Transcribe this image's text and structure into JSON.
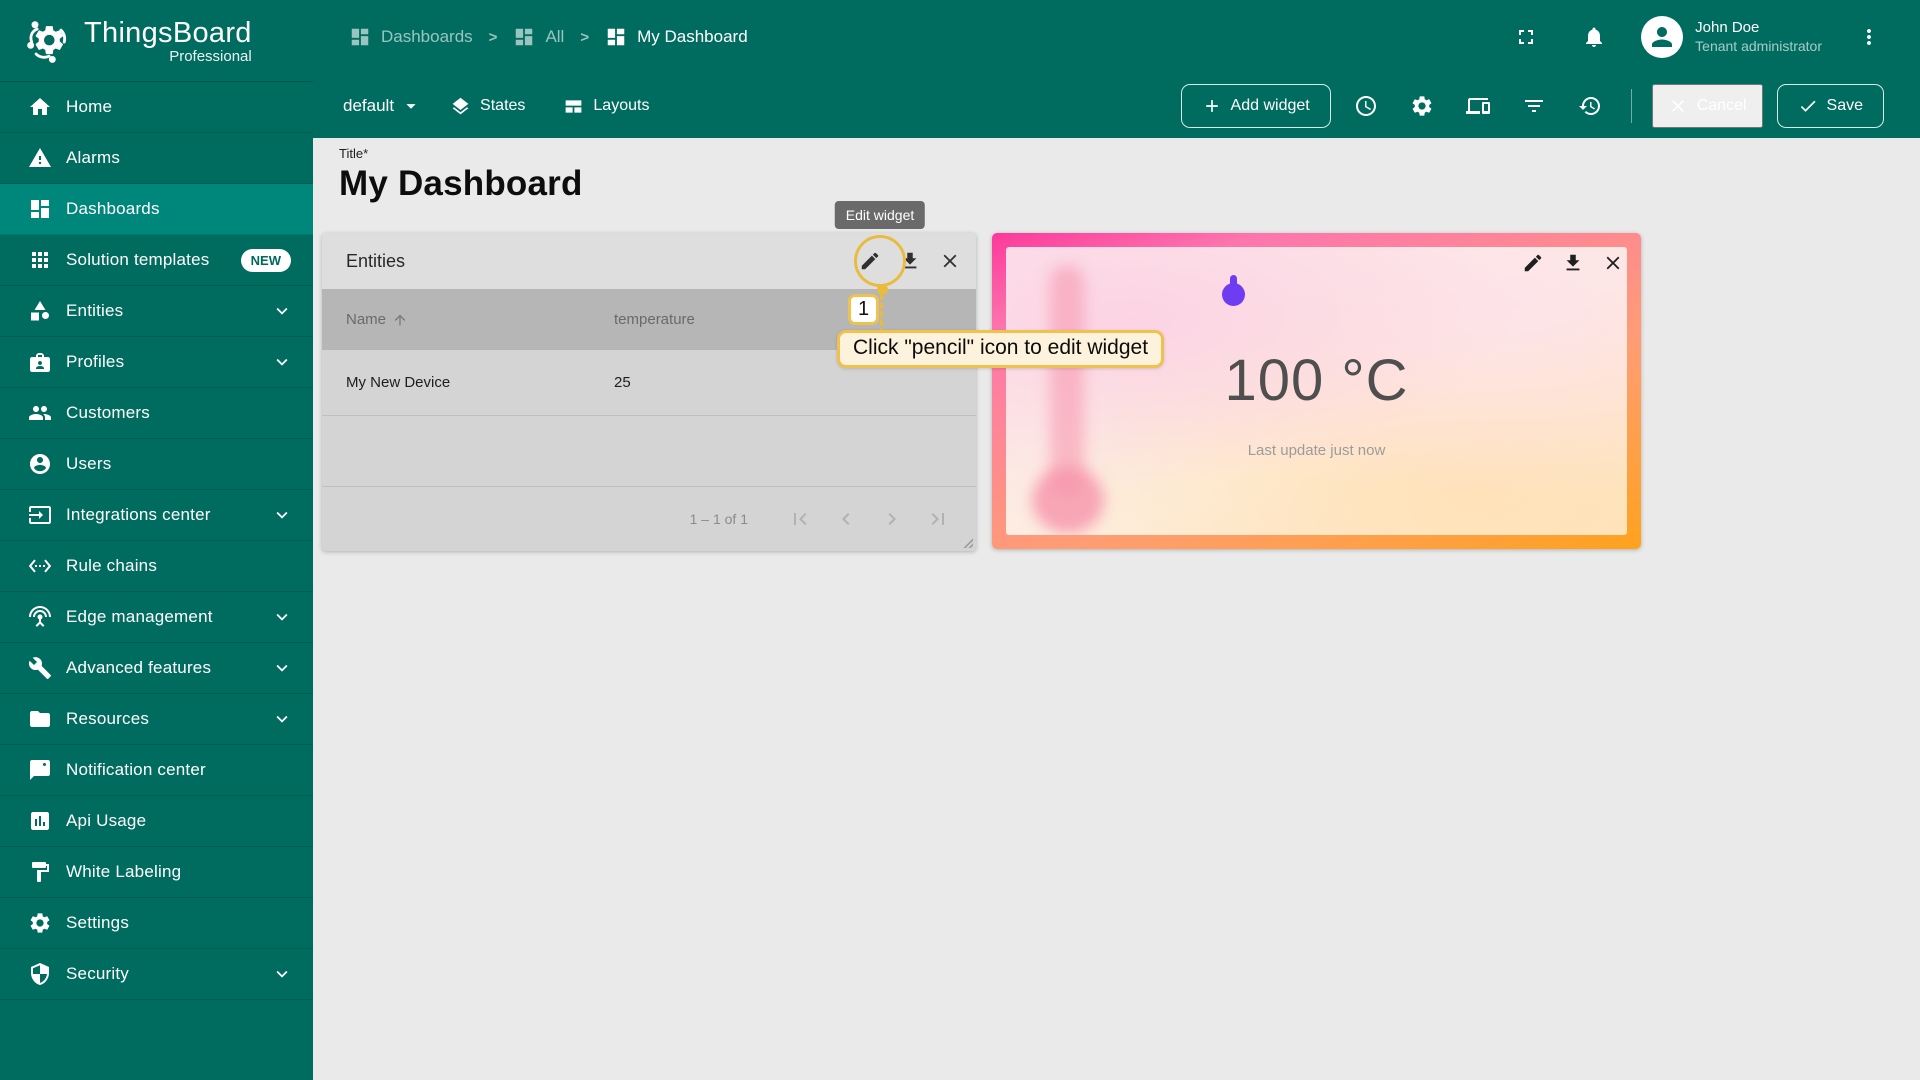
{
  "app": {
    "name": "ThingsBoard",
    "edition": "Professional"
  },
  "sidebar": {
    "items": [
      {
        "label": "Home",
        "icon": "home"
      },
      {
        "label": "Alarms",
        "icon": "alarms"
      },
      {
        "label": "Dashboards",
        "icon": "dashboards",
        "active": true
      },
      {
        "label": "Solution templates",
        "icon": "solution-templates",
        "badge": "NEW"
      },
      {
        "label": "Entities",
        "icon": "entities",
        "expandable": true
      },
      {
        "label": "Profiles",
        "icon": "profiles",
        "expandable": true
      },
      {
        "label": "Customers",
        "icon": "customers"
      },
      {
        "label": "Users",
        "icon": "users"
      },
      {
        "label": "Integrations center",
        "icon": "integrations-center",
        "expandable": true
      },
      {
        "label": "Rule chains",
        "icon": "rule-chains"
      },
      {
        "label": "Edge management",
        "icon": "edge-management",
        "expandable": true
      },
      {
        "label": "Advanced features",
        "icon": "advanced-features",
        "expandable": true
      },
      {
        "label": "Resources",
        "icon": "resources",
        "expandable": true
      },
      {
        "label": "Notification center",
        "icon": "notification-center"
      },
      {
        "label": "Api Usage",
        "icon": "api-usage"
      },
      {
        "label": "White Labeling",
        "icon": "white-labeling"
      },
      {
        "label": "Settings",
        "icon": "settings"
      },
      {
        "label": "Security",
        "icon": "security",
        "expandable": true
      }
    ]
  },
  "breadcrumb": {
    "items": [
      "Dashboards",
      "All",
      "My Dashboard"
    ],
    "separator": ">"
  },
  "topbar": {
    "user_name": "John Doe",
    "user_role": "Tenant administrator"
  },
  "toolbar": {
    "state_label": "default",
    "states_label": "States",
    "layouts_label": "Layouts",
    "add_widget_label": "Add widget",
    "cancel_label": "Cancel",
    "save_label": "Save"
  },
  "page": {
    "title_label": "Title*",
    "title": "My Dashboard"
  },
  "entities_widget": {
    "title": "Entities",
    "columns": {
      "name": "Name",
      "temperature": "temperature"
    },
    "rows": [
      {
        "name": "My New Device",
        "temperature": "25"
      }
    ],
    "pagination_label": "1 – 1 of 1"
  },
  "temperature_widget": {
    "value": "100 °C",
    "last_update": "Last update just now"
  },
  "tutorial": {
    "tooltip": "Edit widget",
    "step_number": "1",
    "instruction": "Click \"pencil\" icon to edit widget"
  },
  "colors": {
    "sidebar_green": "#006B5F",
    "active_item_green": "#00877B",
    "tutorial_gold": "#EFC14D",
    "callout_bg": "#FDF3DC",
    "temp_dot_purple": "#6e3df2"
  }
}
